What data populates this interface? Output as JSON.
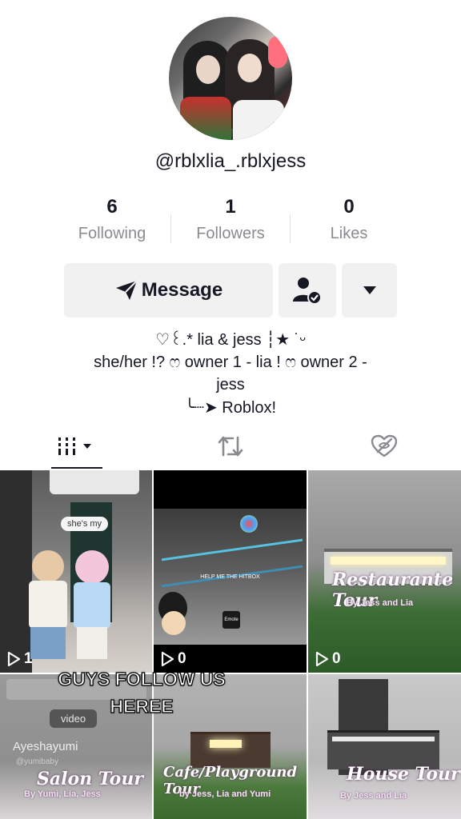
{
  "profile": {
    "username": "@rblxlia_.rblxjess",
    "stats": [
      {
        "value": "6",
        "label": "Following"
      },
      {
        "value": "1",
        "label": "Followers"
      },
      {
        "value": "0",
        "label": "Likes"
      }
    ]
  },
  "actions": {
    "message_label": "Message",
    "follow_icon": "person-check-icon",
    "more_icon": "caret-down-icon"
  },
  "bio": {
    "line1": "♡꒰.* lia & jess ┆★ ˙ᵕ",
    "line2": "she/her !? ෆ owner 1 - lia ! ෆ owner 2 -",
    "line3": "jess",
    "line4_prefix": "╰┈➤",
    "line4_text": "Roblox!"
  },
  "tabs": [
    {
      "name": "videos-grid-tab",
      "icon": "grid-icon",
      "active": true
    },
    {
      "name": "reposts-tab",
      "icon": "repost-icon",
      "active": false
    },
    {
      "name": "liked-tab",
      "icon": "liked-hidden-icon",
      "active": false
    }
  ],
  "videos": [
    {
      "views": "1",
      "caption": "she's my"
    },
    {
      "views": "0",
      "caption": "HELP ME THE HITBOX",
      "small_text": "Emote"
    },
    {
      "views": "0",
      "title": "Restaurante Tour",
      "subtitle": "By Jess and Lia"
    },
    {
      "tag": "video",
      "username": "Ayeshayumi",
      "handle": "@yumibaby",
      "title": "Salon Tour",
      "subtitle": "By Yumi, Lia, Jess"
    },
    {
      "title": "Cafe/Playground Tour",
      "subtitle": "by Jess, Lia and Yumi"
    },
    {
      "title": "House Tour",
      "subtitle": "By Jess and Lia"
    }
  ],
  "overlay_text": {
    "line1": "GUYS FOLLOW US",
    "line2": "HEREE"
  },
  "colors": {
    "text": "#161823",
    "secondary": "#8a8b91",
    "button_bg": "#f1f1f2"
  }
}
